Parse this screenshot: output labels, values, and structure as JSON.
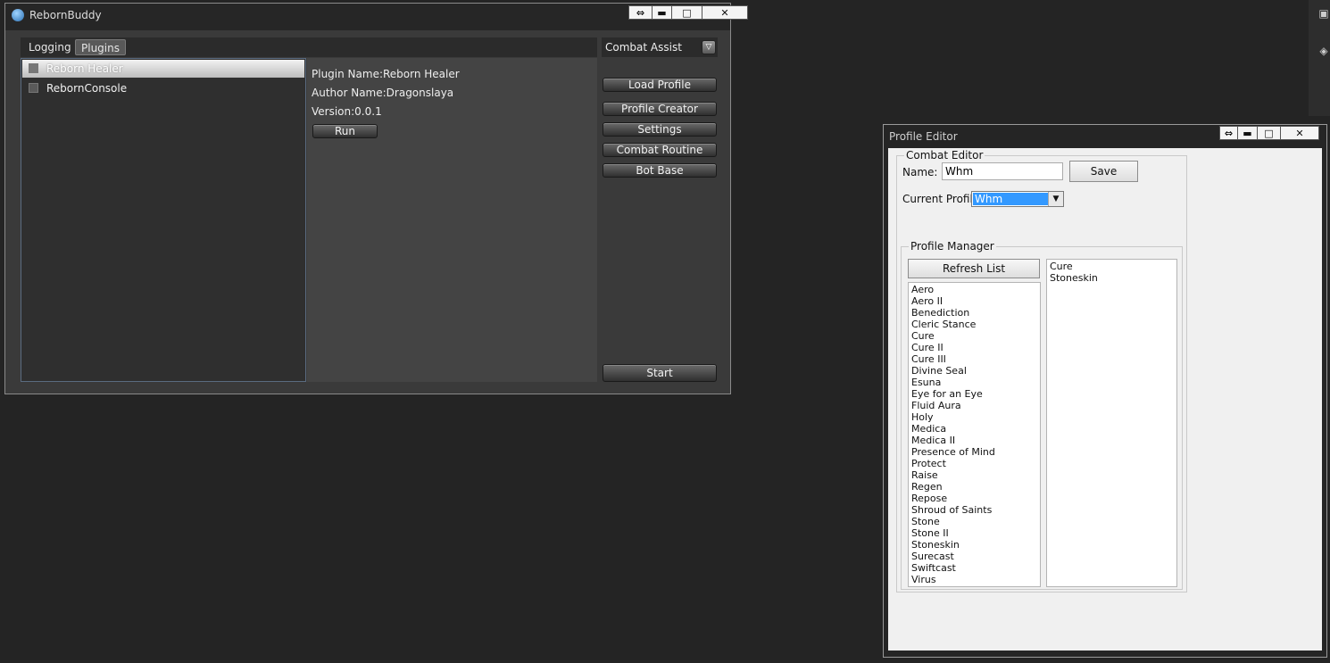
{
  "main_window": {
    "title": "RebornBuddy",
    "controls": {
      "restore": "⇔",
      "minimize": "▬",
      "maximize": "□",
      "close": "✕"
    },
    "tabs": [
      {
        "label": "Logging",
        "active": false
      },
      {
        "label": "Plugins",
        "active": true
      }
    ],
    "plugins": [
      {
        "label": "Reborn Healer",
        "selected": true,
        "checked": false
      },
      {
        "label": "RebornConsole",
        "selected": false,
        "checked": false
      }
    ],
    "details": {
      "plugin_name": "Plugin Name:Reborn Healer",
      "author": "Author Name:Dragonslaya",
      "version": "Version:0.0.1",
      "run_label": "Run"
    },
    "mode_select": {
      "value": "Combat Assist",
      "arrow": "▽"
    },
    "buttons": {
      "load_profile": "Load Profile",
      "profile_creator": "Profile Creator",
      "settings": "Settings",
      "combat_routine": "Combat Routine",
      "bot_base": "Bot Base",
      "start": "Start"
    }
  },
  "profile_editor": {
    "title": "Profile Editor",
    "controls": {
      "restore": "⇔",
      "minimize": "▬",
      "maximize": "□",
      "close": "✕"
    },
    "combat_editor": {
      "group_label": "Combat Editor",
      "name_label": "Name:",
      "name_value": "Whm",
      "save_label": "Save",
      "current_profile_label": "Current Profile",
      "current_profile_value": "Whm",
      "dropdown_arrow": "▼"
    },
    "profile_manager": {
      "group_label": "Profile Manager",
      "refresh_label": "Refresh List",
      "abilities": [
        "Aero",
        "Aero II",
        "Benediction",
        "Cleric Stance",
        "Cure",
        "Cure II",
        "Cure III",
        "Divine Seal",
        "Esuna",
        "Eye for an Eye",
        "Fluid Aura",
        "Holy",
        "Medica",
        "Medica II",
        "Presence of Mind",
        "Protect",
        "Raise",
        "Regen",
        "Repose",
        "Shroud of Saints",
        "Stone",
        "Stone II",
        "Stoneskin",
        "Surecast",
        "Swiftcast",
        "Virus"
      ],
      "profile_abilities": [
        "Cure",
        "Stoneskin"
      ]
    }
  },
  "colors": {
    "desktop": "#242424",
    "selection_highlight": "#3399ff",
    "dialog_background": "#f0f0f0"
  }
}
